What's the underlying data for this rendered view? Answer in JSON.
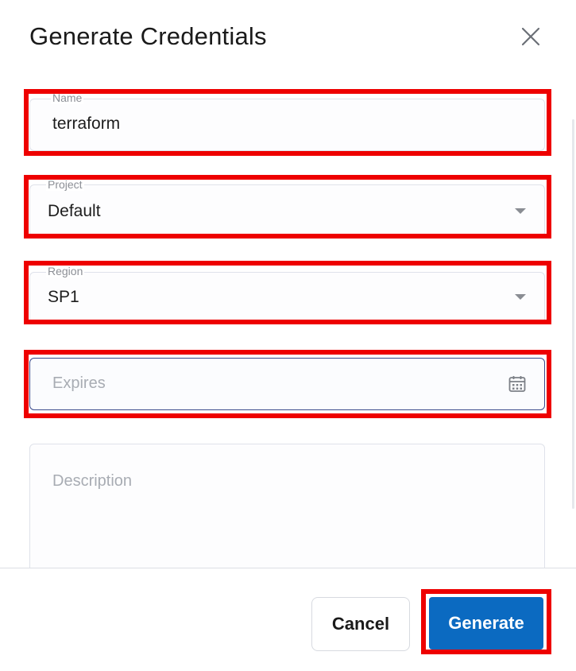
{
  "dialog": {
    "title": "Generate Credentials",
    "close_icon": "close-icon"
  },
  "form": {
    "name": {
      "label": "Name",
      "value": "terraform"
    },
    "project": {
      "label": "Project",
      "value": "Default",
      "icon": "chevron-down-icon"
    },
    "region": {
      "label": "Region",
      "value": "SP1",
      "icon": "chevron-down-icon"
    },
    "expires": {
      "placeholder": "Expires",
      "icon": "calendar-icon"
    },
    "description": {
      "placeholder": "Description"
    }
  },
  "footer": {
    "cancel_label": "Cancel",
    "generate_label": "Generate"
  },
  "colors": {
    "primary": "#0b6ac1",
    "highlight": "#ee0000",
    "focus_border": "#3a4a8c"
  }
}
